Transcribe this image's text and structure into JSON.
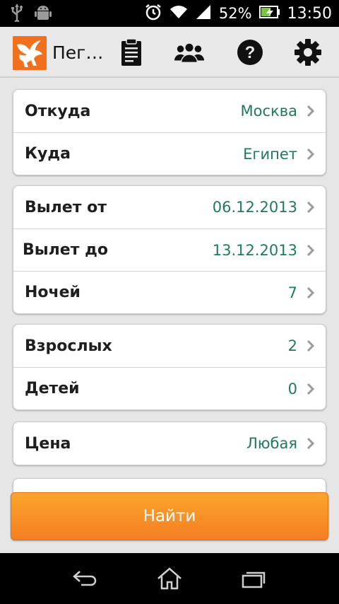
{
  "status_bar": {
    "battery_percent": "52%",
    "time": "13:50",
    "icons": [
      "usb-icon",
      "android-debug-icon",
      "alarm-icon",
      "wifi-icon",
      "signal-icon",
      "battery-charging-icon"
    ]
  },
  "action_bar": {
    "title": "Пег…",
    "icons": [
      "clipboard-icon",
      "group-icon",
      "help-icon",
      "settings-icon"
    ]
  },
  "form": {
    "groups": [
      {
        "rows": [
          {
            "label": "Откуда",
            "value": "Москва"
          },
          {
            "label": "Куда",
            "value": "Египет"
          }
        ]
      },
      {
        "rows": [
          {
            "label": "Вылет от",
            "value": "06.12.2013"
          },
          {
            "label": "Вылет до",
            "value": "13.12.2013"
          },
          {
            "label": "Ночей",
            "value": "7"
          }
        ]
      },
      {
        "rows": [
          {
            "label": "Взрослых",
            "value": "2"
          },
          {
            "label": "Детей",
            "value": "0"
          }
        ]
      },
      {
        "rows": [
          {
            "label": "Цена",
            "value": "Любая"
          }
        ]
      }
    ]
  },
  "search_button": {
    "label": "Найти"
  },
  "nav_bar": {
    "icons": [
      "back-icon",
      "home-icon",
      "recent-apps-icon"
    ]
  },
  "colors": {
    "accent_value": "#1f7a5c",
    "button_orange": "#f7901f",
    "logo_orange": "#f0701d"
  }
}
